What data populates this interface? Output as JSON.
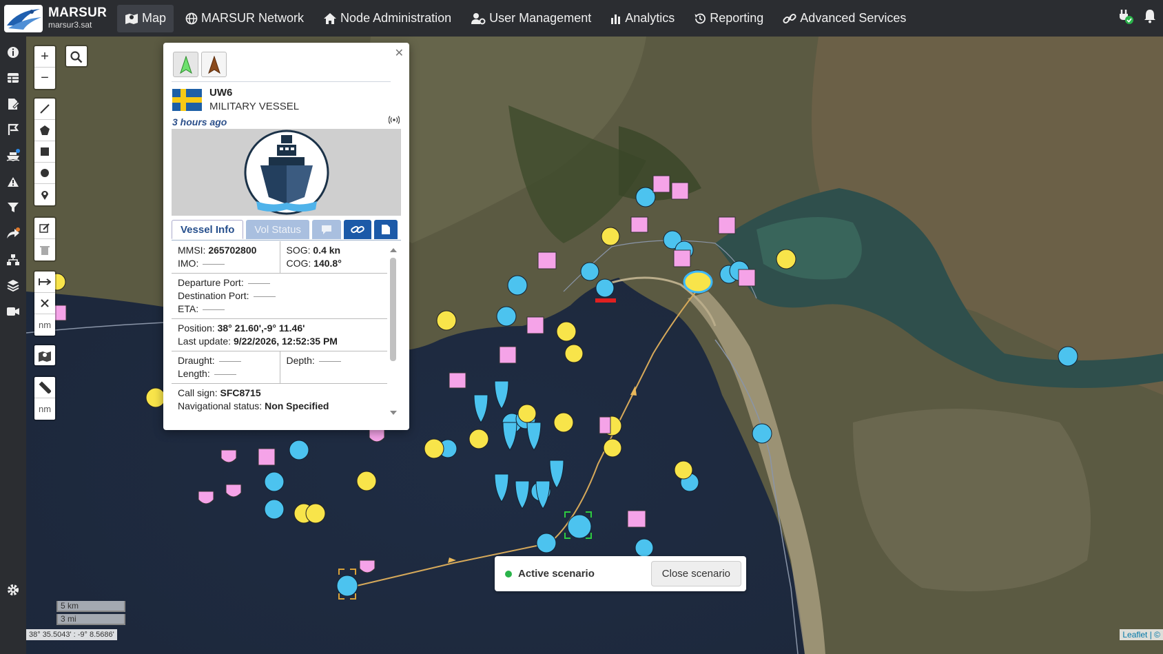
{
  "app": {
    "title": "MARSUR",
    "subtitle": "marsur3.sat"
  },
  "nav": [
    {
      "label": "Map",
      "icon": "map-icon"
    },
    {
      "label": "MARSUR Network",
      "icon": "globe-icon"
    },
    {
      "label": "Node Administration",
      "icon": "home-icon"
    },
    {
      "label": "User Management",
      "icon": "users-gear-icon"
    },
    {
      "label": "Analytics",
      "icon": "bar-chart-icon"
    },
    {
      "label": "Reporting",
      "icon": "history-icon"
    },
    {
      "label": "Advanced Services",
      "icon": "link-icon"
    }
  ],
  "map_controls": {
    "nm_label_1": "nm",
    "nm_label_2": "nm",
    "zoom_in": "+",
    "zoom_out": "−"
  },
  "popup": {
    "name": "UW6",
    "type": "MILITARY VESSEL",
    "ago": "3 hours ago",
    "tabs": {
      "vessel_info": "Vessel Info",
      "vol_status": "Vol Status"
    },
    "mmsi_label": "MMSI:",
    "mmsi": "265702800",
    "imo_label": "IMO:",
    "sog_label": "SOG:",
    "sog": "0.4 kn",
    "cog_label": "COG:",
    "cog": "140.8°",
    "departure_label": "Departure Port:",
    "destination_label": "Destination Port:",
    "eta_label": "ETA:",
    "position_label": "Position:",
    "position": "38° 21.60',-9° 11.46'",
    "lastupdate_label": "Last update:",
    "lastupdate": "9/22/2026, 12:52:35 PM",
    "draught_label": "Draught:",
    "length_label": "Length:",
    "depth_label": "Depth:",
    "callsign_label": "Call sign:",
    "callsign": "SFC8715",
    "navstatus_label": "Navigational status:",
    "navstatus": "Non Specified"
  },
  "scale": {
    "km": "5 km",
    "mi": "3 mi"
  },
  "coords": "38° 35.5043' : -9° 8.5686'",
  "attribution": "Leaflet | ©",
  "scenario": {
    "label": "Active scenario",
    "button": "Close scenario",
    "status_color": "#2ab34a"
  }
}
